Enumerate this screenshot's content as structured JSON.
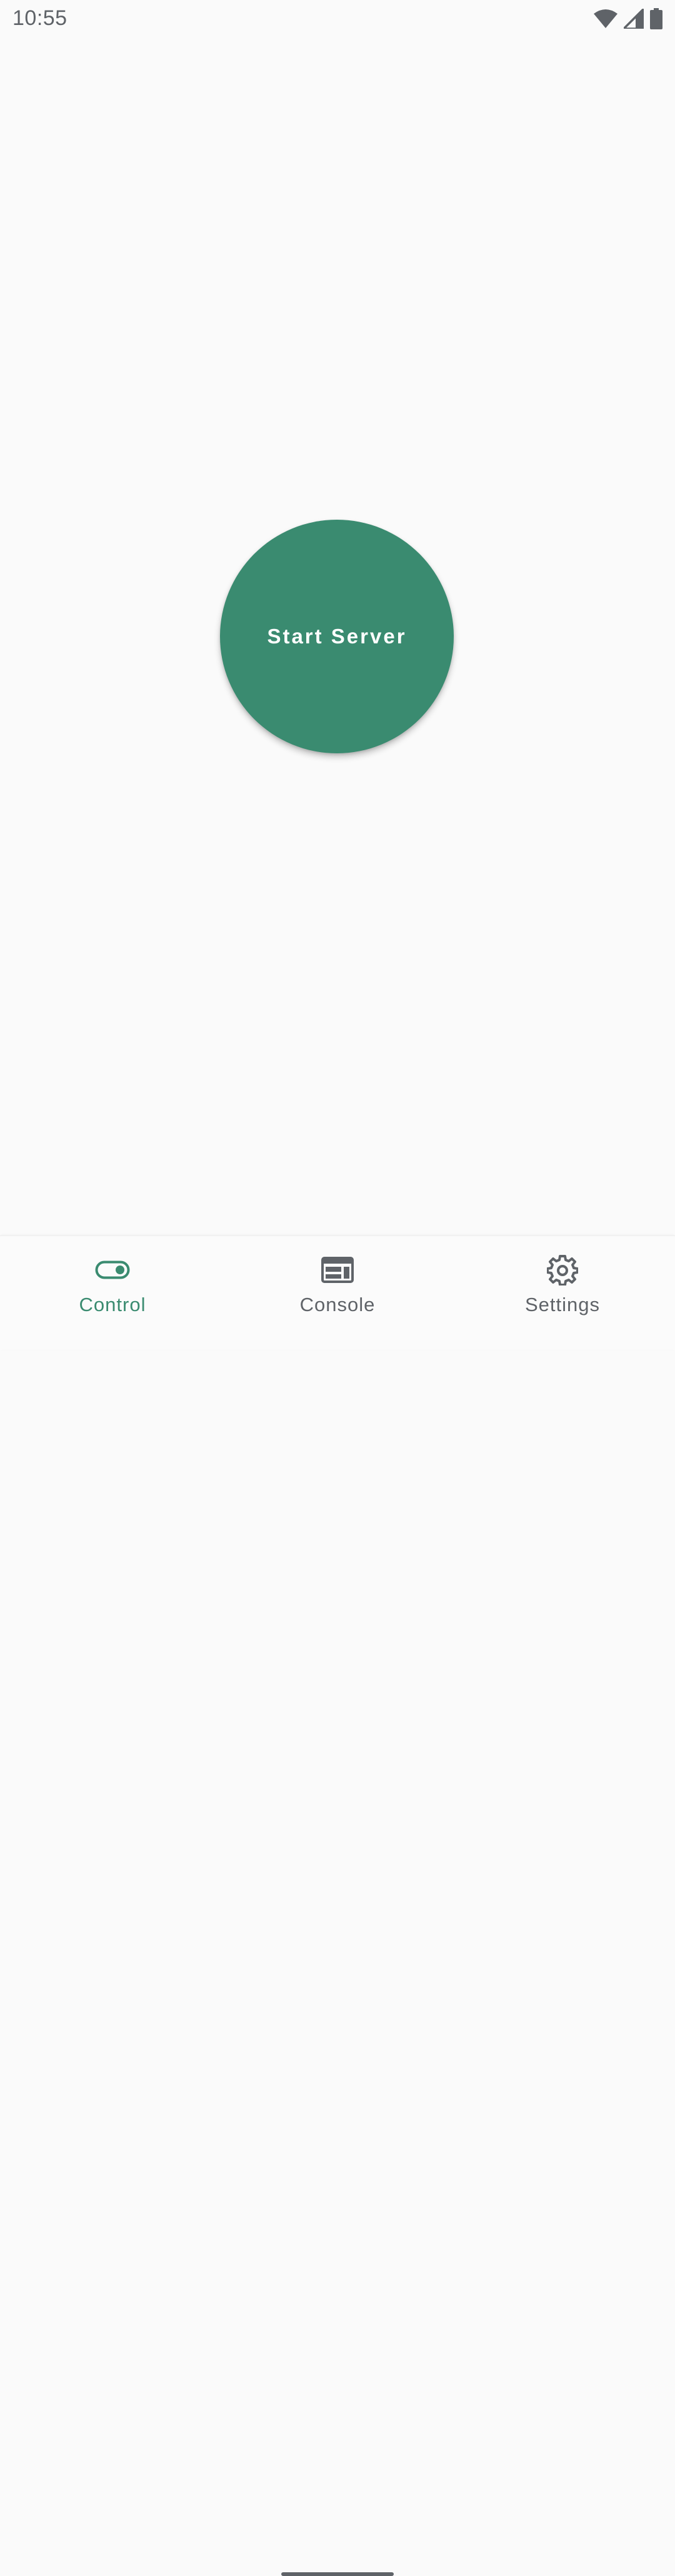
{
  "status_bar": {
    "time": "10:55",
    "icons": [
      "wifi-icon",
      "signal-icon",
      "battery-icon"
    ]
  },
  "main": {
    "start_button_label": "Start Server"
  },
  "bottom_nav": {
    "items": [
      {
        "label": "Control",
        "icon": "toggle-icon",
        "active": true
      },
      {
        "label": "Console",
        "icon": "console-icon",
        "active": false
      },
      {
        "label": "Settings",
        "icon": "gear-icon",
        "active": false
      }
    ]
  },
  "colors": {
    "accent": "#3a8b70",
    "background": "#fafafa",
    "inactive_text": "#5f6368",
    "on_accent_text": "#ffffff"
  }
}
